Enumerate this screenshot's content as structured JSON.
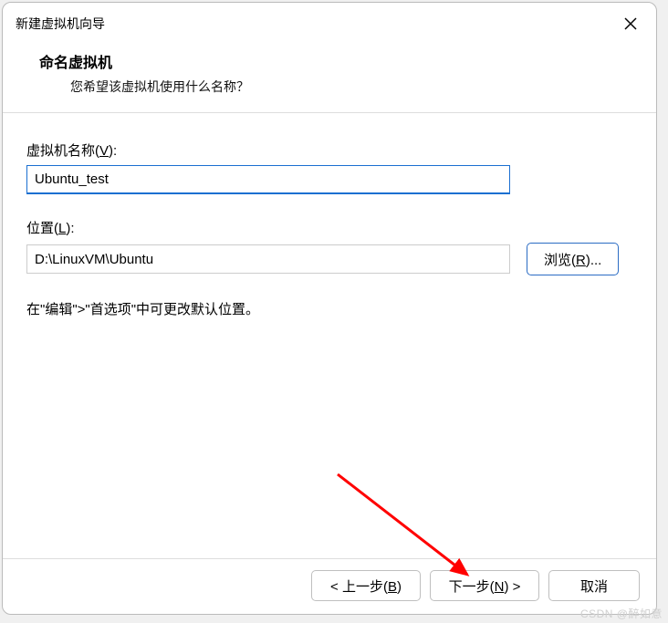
{
  "titlebar": {
    "title": "新建虚拟机向导"
  },
  "header": {
    "heading": "命名虚拟机",
    "subtext": "您希望该虚拟机使用什么名称？"
  },
  "fields": {
    "name": {
      "label_prefix": "虚拟机名称(",
      "label_hotkey": "V",
      "label_suffix": "):",
      "value": "Ubuntu_test"
    },
    "location": {
      "label_prefix": "位置(",
      "label_hotkey": "L",
      "label_suffix": "):",
      "value": "D:\\LinuxVM\\Ubuntu"
    },
    "browse": {
      "label_prefix": "浏览(",
      "label_hotkey": "R",
      "label_suffix": ")..."
    },
    "hint": "在\"编辑\">\"首选项\"中可更改默认位置。"
  },
  "footer": {
    "back": {
      "prefix": "< 上一步(",
      "hotkey": "B",
      "suffix": ")"
    },
    "next": {
      "prefix": "下一步(",
      "hotkey": "N",
      "suffix": ") >"
    },
    "cancel": {
      "label": "取消"
    }
  },
  "watermark": "CSDN @醉如意"
}
